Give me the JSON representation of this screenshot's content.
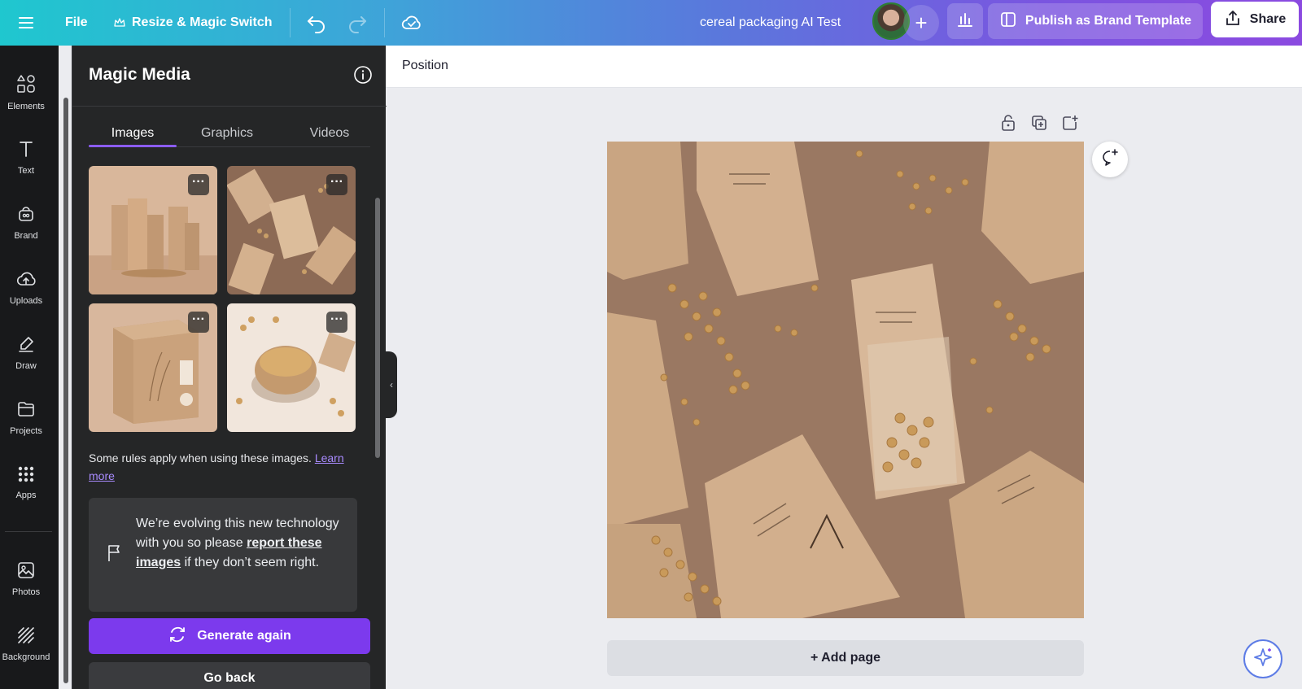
{
  "topbar": {
    "menu_icon": "hamburger-menu-icon",
    "file_label": "File",
    "resize_label": "Resize & Magic Switch",
    "document_title": "cereal packaging AI Test",
    "publish_label": "Publish as Brand Template",
    "share_label": "Share"
  },
  "rail": {
    "items": [
      {
        "label": "Elements",
        "icon": "elements-icon"
      },
      {
        "label": "Text",
        "icon": "text-icon"
      },
      {
        "label": "Brand",
        "icon": "brand-icon"
      },
      {
        "label": "Uploads",
        "icon": "uploads-icon"
      },
      {
        "label": "Draw",
        "icon": "draw-icon"
      },
      {
        "label": "Projects",
        "icon": "projects-icon"
      },
      {
        "label": "Apps",
        "icon": "apps-icon"
      },
      {
        "label": "Photos",
        "icon": "photos-icon"
      },
      {
        "label": "Background",
        "icon": "background-icon"
      }
    ]
  },
  "panel": {
    "title": "Magic Media",
    "tabs": [
      "Images",
      "Graphics",
      "Videos"
    ],
    "active_tab": "Images",
    "rules_text": "Some rules apply when using these images.",
    "rules_link": "Learn more",
    "notice_pre": "We’re evolving this new technology with you so please",
    "notice_link": "report these images",
    "notice_post": "if they don’t seem right.",
    "generate_label": "Generate again",
    "back_label": "Go back",
    "more_glyph": "···"
  },
  "canvas": {
    "position_label": "Position",
    "add_page_label": "+ Add page"
  },
  "colors": {
    "accent": "#7c3aed",
    "panel_bg": "#252627",
    "rail_bg": "#18191b"
  }
}
